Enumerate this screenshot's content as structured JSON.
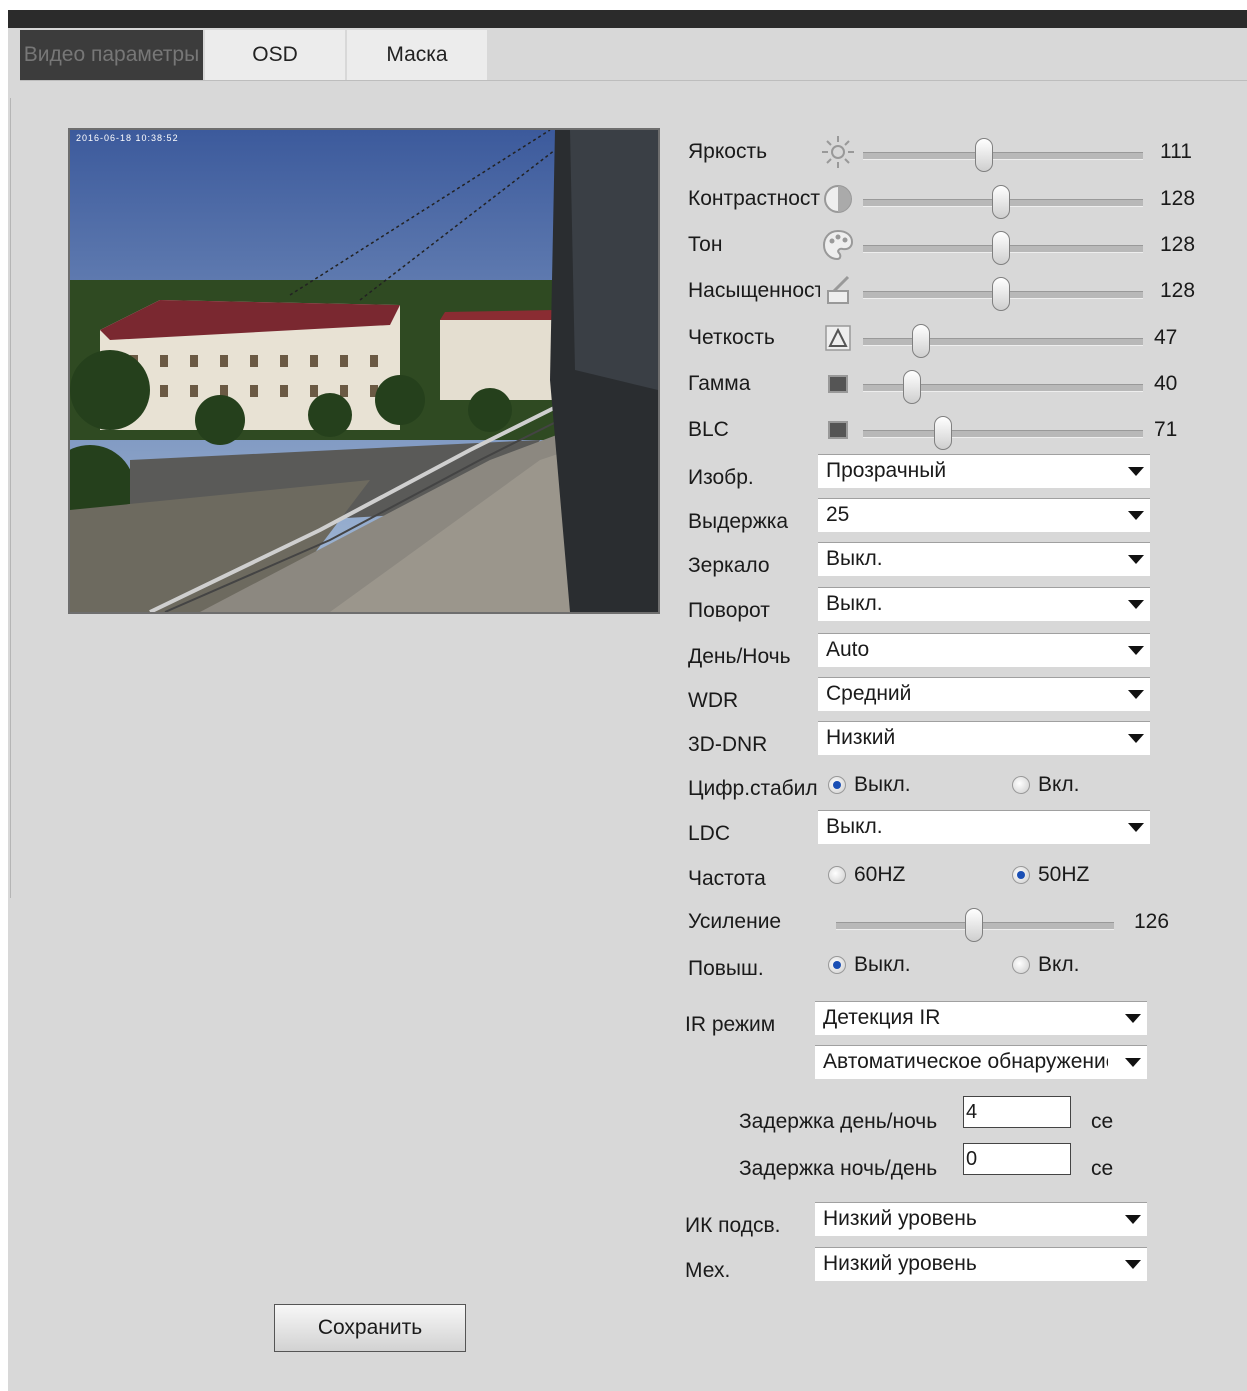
{
  "tabs": [
    "Видео параметры",
    "OSD",
    "Маска"
  ],
  "preview": {
    "osd_text": "2016-06-18 10:38:52"
  },
  "sliders": [
    {
      "label": "Яркость",
      "icon": "brightness-icon",
      "value": "111",
      "fraction": 0.44
    },
    {
      "label": "Контрастность",
      "icon": "contrast-icon",
      "value": "128",
      "fraction": 0.5
    },
    {
      "label": "Тон",
      "icon": "palette-icon",
      "value": "128",
      "fraction": 0.5
    },
    {
      "label": "Насыщенность",
      "icon": "saturation-icon",
      "value": "128",
      "fraction": 0.5
    },
    {
      "label": "Четкость",
      "icon": "sharpness-icon",
      "value": "47",
      "fraction": 0.21
    },
    {
      "label": "Гамма",
      "icon": "gamma-icon",
      "value": "40",
      "fraction": 0.18
    },
    {
      "label": "BLC",
      "icon": "blc-icon",
      "value": "71",
      "fraction": 0.3
    }
  ],
  "selects": [
    {
      "label": "Изобр.",
      "value": "Прозрачный"
    },
    {
      "label": "Выдержка",
      "value": "25"
    },
    {
      "label": "Зеркало",
      "value": "Выкл."
    },
    {
      "label": "Поворот",
      "value": "Выкл."
    },
    {
      "label": "День/Ночь",
      "value": "Auto"
    },
    {
      "label": "WDR",
      "value": "Средний"
    },
    {
      "label": "3D-DNR",
      "value": "Низкий"
    }
  ],
  "stabilization": {
    "label": "Цифр.стабил",
    "off": "Выкл.",
    "on": "Вкл.",
    "selected": "off"
  },
  "ldc": {
    "label": "LDC",
    "value": "Выкл."
  },
  "frequency": {
    "label": "Частота",
    "opt1": "60HZ",
    "opt2": "50HZ",
    "selected": "50HZ"
  },
  "gain": {
    "label": "Усиление",
    "value": "126",
    "fraction": 0.5
  },
  "enhance": {
    "label": "Повыш.",
    "off": "Выкл.",
    "on": "Вкл.",
    "selected": "off"
  },
  "ir_mode": {
    "label": "IR режим",
    "value": "Детекция IR",
    "sub_value": "Автоматическое обнаружение"
  },
  "delay_day_night": {
    "label": "Задержка день/ночь",
    "value": "4",
    "unit": "се"
  },
  "delay_night_day": {
    "label": "Задержка ночь/день",
    "value": "0",
    "unit": "се"
  },
  "ir_light": {
    "label": "ИК подсв.",
    "value": "Низкий уровень"
  },
  "mech": {
    "label": "Мех.",
    "value": "Низкий уровень"
  },
  "save_label": "Сохранить"
}
